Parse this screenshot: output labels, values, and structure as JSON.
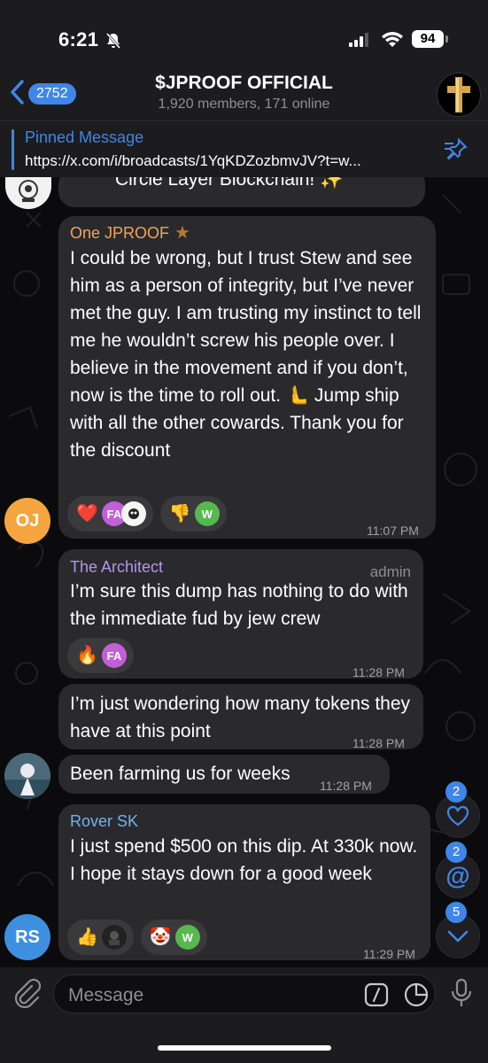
{
  "status_bar": {
    "time": "6:21",
    "battery": "94"
  },
  "header": {
    "back_count": "2752",
    "title": "$JPROOF OFFICIAL",
    "subtitle": "1,920 members, 171 online"
  },
  "pinned": {
    "title": "Pinned Message",
    "text": "https://x.com/i/broadcasts/1YqKDZozbmvJV?t=w..."
  },
  "messages": {
    "m0": {
      "text": "Circle Layer Blockchain! ✨"
    },
    "m1": {
      "sender": "One JPROOF",
      "text": "I could be wrong, but I trust Stew and see him as a person of integrity, but I’ve never met the guy. I am trusting my instinct to tell me he wouldn’t screw his people over. I believe in the movement and if you don’t, now is the time to roll out. 🫷 Jump ship with all the other cowards. Thank you for the discount",
      "time": "11:07 PM",
      "avatar": "OJ",
      "reactions": [
        {
          "emoji": "❤️",
          "avatars": [
            "FA",
            ""
          ]
        },
        {
          "emoji": "👎",
          "avatars": [
            "W"
          ]
        }
      ]
    },
    "m2": {
      "sender": "The Architect",
      "role": "admin",
      "text": "I’m sure this dump has nothing to do with the immediate fud by jew crew",
      "time": "11:28 PM",
      "reactions": [
        {
          "emoji": "🔥",
          "avatars": [
            "FA"
          ]
        }
      ]
    },
    "m3": {
      "text": "I’m just wondering how many tokens they have at this point",
      "time": "11:28 PM"
    },
    "m4": {
      "text": "Been farming us for weeks",
      "time": "11:28 PM"
    },
    "m5": {
      "sender": "Rover SK",
      "text": "I just spend $500 on this dip. At 330k now. I hope it stays down for a good week",
      "time": "11:29 PM",
      "avatar": "RS",
      "reactions": [
        {
          "emoji": "👍",
          "avatars": [
            ""
          ]
        },
        {
          "emoji": "🤡",
          "avatars": [
            "W"
          ]
        }
      ]
    }
  },
  "side_buttons": {
    "reactions_count": "2",
    "mentions_count": "2",
    "down_count": "5"
  },
  "input": {
    "placeholder": "Message"
  },
  "colors": {
    "accent": "#3e86e8",
    "bubble": "#2a2a2c",
    "name_one_jproof": "#f0a45c",
    "name_architect": "#b892f0",
    "name_rover": "#6fb4f2"
  }
}
